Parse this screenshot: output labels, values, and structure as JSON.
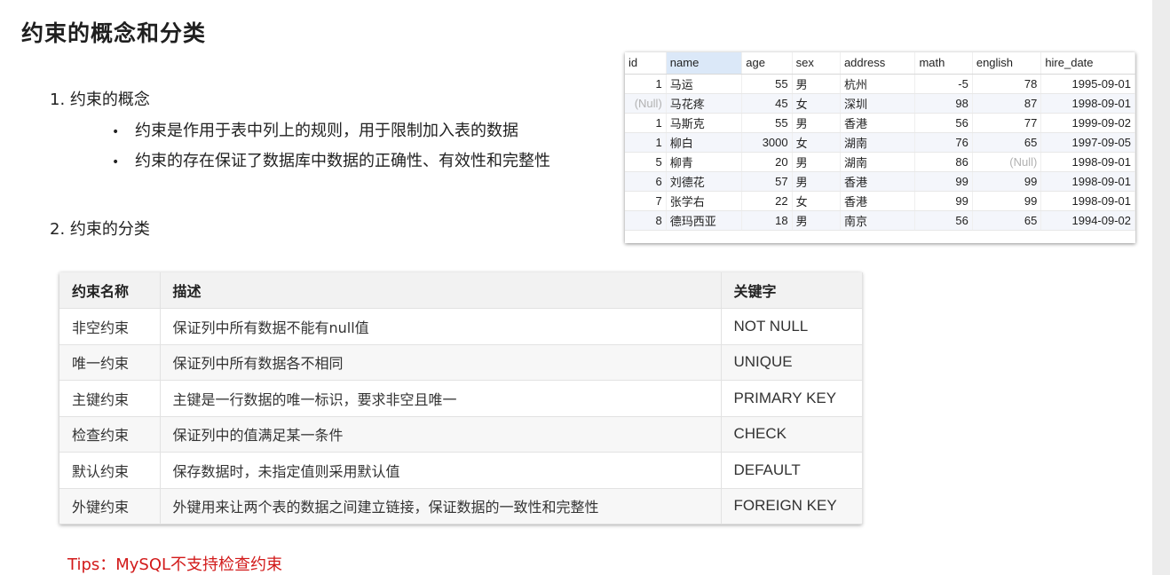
{
  "title": "约束的概念和分类",
  "section1": {
    "heading": "1. 约束的概念",
    "bullets": [
      "约束是作用于表中列上的规则，用于限制加入表的数据",
      "约束的存在保证了数据库中数据的正确性、有效性和完整性"
    ]
  },
  "section2": {
    "heading": "2. 约束的分类"
  },
  "db_grid": {
    "columns": [
      "id",
      "name",
      "age",
      "sex",
      "address",
      "math",
      "english",
      "hire_date"
    ],
    "rows": [
      [
        "1",
        "马运",
        "55",
        "男",
        "杭州",
        "-5",
        "78",
        "1995-09-01"
      ],
      [
        "(Null)",
        "马花疼",
        "45",
        "女",
        "深圳",
        "98",
        "87",
        "1998-09-01"
      ],
      [
        "1",
        "马斯克",
        "55",
        "男",
        "香港",
        "56",
        "77",
        "1999-09-02"
      ],
      [
        "1",
        "柳白",
        "3000",
        "女",
        "湖南",
        "76",
        "65",
        "1997-09-05"
      ],
      [
        "5",
        "柳青",
        "20",
        "男",
        "湖南",
        "86",
        "(Null)",
        "1998-09-01"
      ],
      [
        "6",
        "刘德花",
        "57",
        "男",
        "香港",
        "99",
        "99",
        "1998-09-01"
      ],
      [
        "7",
        "张学右",
        "22",
        "女",
        "香港",
        "99",
        "99",
        "1998-09-01"
      ],
      [
        "8",
        "德玛西亚",
        "18",
        "男",
        "南京",
        "56",
        "65",
        "1994-09-02"
      ]
    ]
  },
  "constraint_table": {
    "headers": [
      "约束名称",
      "描述",
      "关键字"
    ],
    "rows": [
      [
        "非空约束",
        "保证列中所有数据不能有null值",
        "NOT NULL"
      ],
      [
        "唯一约束",
        "保证列中所有数据各不相同",
        "UNIQUE"
      ],
      [
        "主键约束",
        "主键是一行数据的唯一标识，要求非空且唯一",
        "PRIMARY KEY"
      ],
      [
        "检查约束",
        "保证列中的值满足某一条件",
        "CHECK"
      ],
      [
        "默认约束",
        "保存数据时，未指定值则采用默认值",
        "DEFAULT"
      ],
      [
        "外键约束",
        "外键用来让两个表的数据之间建立链接，保证数据的一致性和完整性",
        "FOREIGN KEY"
      ]
    ]
  },
  "tips": "Tips：MySQL不支持检查约束",
  "colors": {
    "tips": "#d21a1a",
    "selected_header": "#dbe8f8",
    "null_text": "#b2b2b2"
  }
}
